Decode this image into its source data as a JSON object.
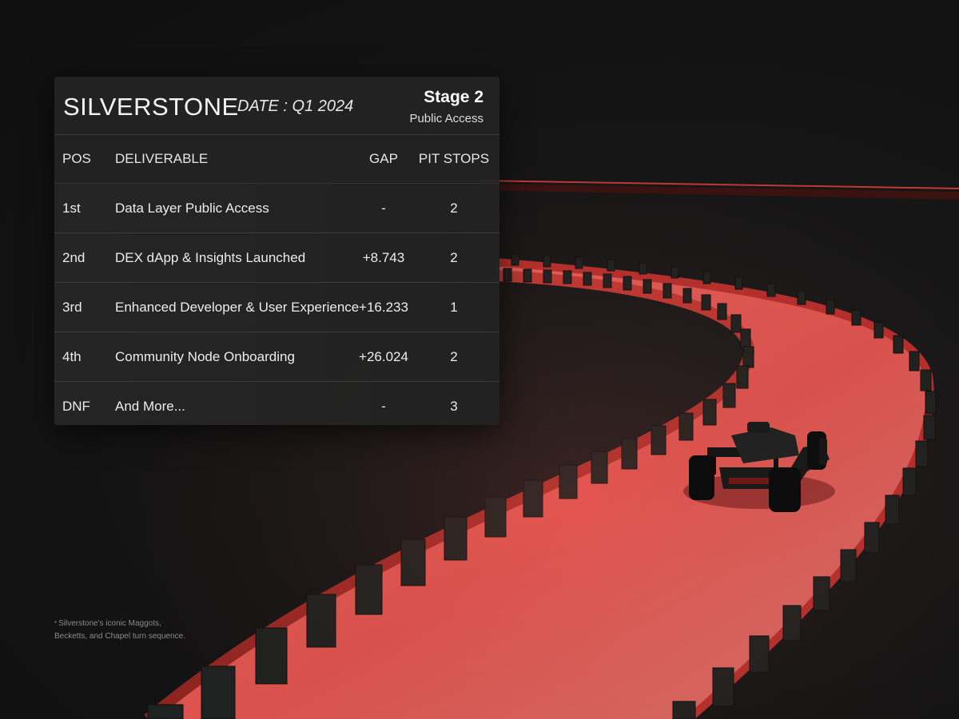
{
  "header": {
    "track_name": "SILVERSTONE",
    "date": "DATE : Q1 2024",
    "stage_title": "Stage 2",
    "stage_subtitle": "Public Access"
  },
  "columns": {
    "pos": "POS",
    "deliverable": "DELIVERABLE",
    "gap": "GAP",
    "pit_stops": "PIT STOPS"
  },
  "rows": [
    {
      "pos": "1st",
      "deliverable": "Data Layer Public Access",
      "gap": "-",
      "pit_stops": "2"
    },
    {
      "pos": "2nd",
      "deliverable": "DEX dApp & Insights Launched",
      "gap": "+8.743",
      "pit_stops": "2"
    },
    {
      "pos": "3rd",
      "deliverable": "Enhanced Developer & User Experience",
      "gap": "+16.233",
      "pit_stops": "1"
    },
    {
      "pos": "4th",
      "deliverable": "Community Node Onboarding",
      "gap": "+26.024",
      "pit_stops": "2"
    },
    {
      "pos": "DNF",
      "deliverable": "And More...",
      "gap": "-",
      "pit_stops": "3"
    }
  ],
  "footnote": {
    "marker": "*",
    "line1": "Silverstone's iconic Maggots,",
    "line2": "Becketts, and Chapel turn sequence."
  },
  "colors": {
    "background": "#121212",
    "track_red": "#e0544f",
    "track_edge": "#b8302c",
    "barrier": "#1e2220",
    "panel": "#242424"
  },
  "icons": {
    "car": "race-car-illustration"
  }
}
